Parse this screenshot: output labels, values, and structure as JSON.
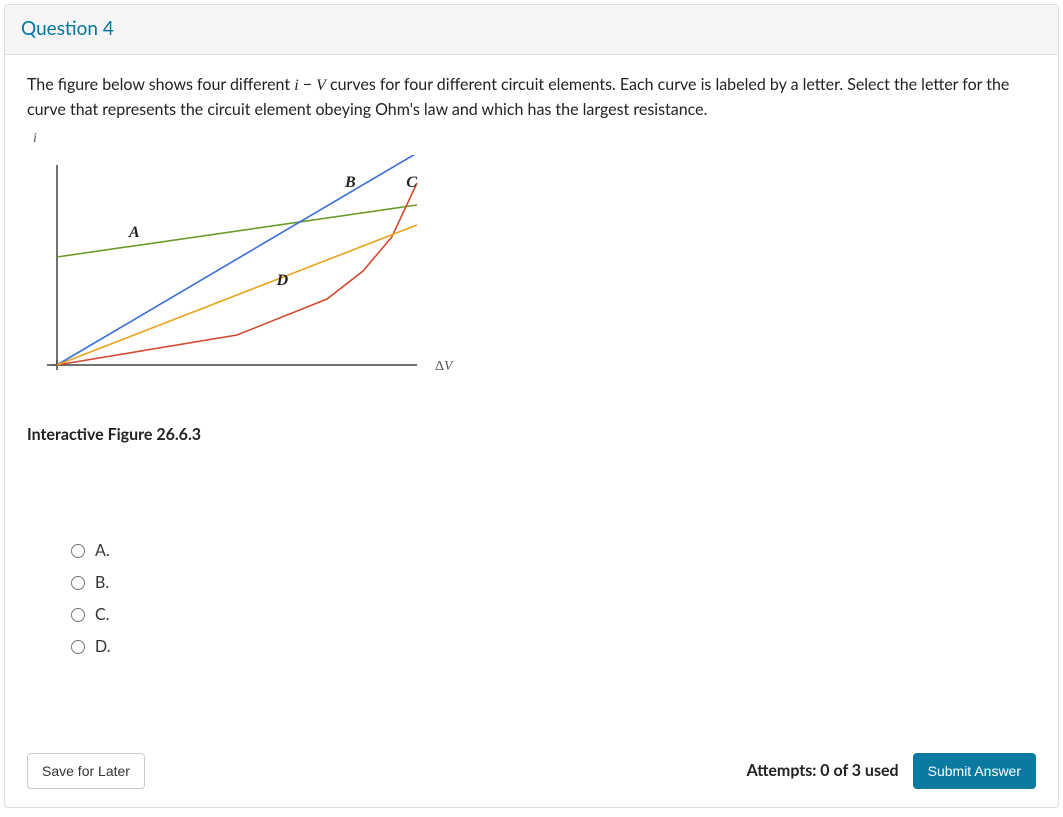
{
  "header": {
    "title": "Question 4"
  },
  "main": {
    "prompt_pre": "The figure below shows four different ",
    "prompt_ital1": "i",
    "prompt_sep": " − ",
    "prompt_ital2": "V",
    "prompt_post": " curves for four different circuit elements.  Each curve is labeled by a letter. Select the letter for the curve that represents the circuit element obeying Ohm's law and which has the largest resistance.",
    "yaxis_top_label": "i",
    "figure_caption": "Interactive Figure 26.6.3"
  },
  "chart_data": {
    "type": "line",
    "xlabel": "ΔV",
    "ylabel": "i",
    "xlim": [
      0,
      10
    ],
    "ylim": [
      0,
      10
    ],
    "series": [
      {
        "name": "A",
        "color": "#6b9b2a",
        "label_pos": [
          2.0,
          6.4
        ],
        "x": [
          0,
          10
        ],
        "y": [
          5.4,
          8.0
        ]
      },
      {
        "name": "B",
        "color": "#3b6fd6",
        "label_pos": [
          8.0,
          8.9
        ],
        "x": [
          0,
          10
        ],
        "y": [
          0,
          10.6
        ]
      },
      {
        "name": "C",
        "color": "#d24a2f",
        "label_pos": [
          9.7,
          8.9
        ],
        "x": [
          0,
          5,
          7.5,
          8.5,
          9.3,
          10
        ],
        "y": [
          0,
          1.5,
          3.3,
          4.7,
          6.4,
          9.1
        ]
      },
      {
        "name": "D",
        "color": "#e6a321",
        "label_pos": [
          6.1,
          4.0
        ],
        "x": [
          0,
          10
        ],
        "y": [
          0,
          7.0
        ]
      }
    ]
  },
  "options": {
    "items": [
      {
        "label": "A."
      },
      {
        "label": "B."
      },
      {
        "label": "C."
      },
      {
        "label": "D."
      }
    ]
  },
  "footer": {
    "save_label": "Save for Later",
    "attempts_text": "Attempts: 0 of 3 used",
    "submit_label": "Submit Answer"
  }
}
